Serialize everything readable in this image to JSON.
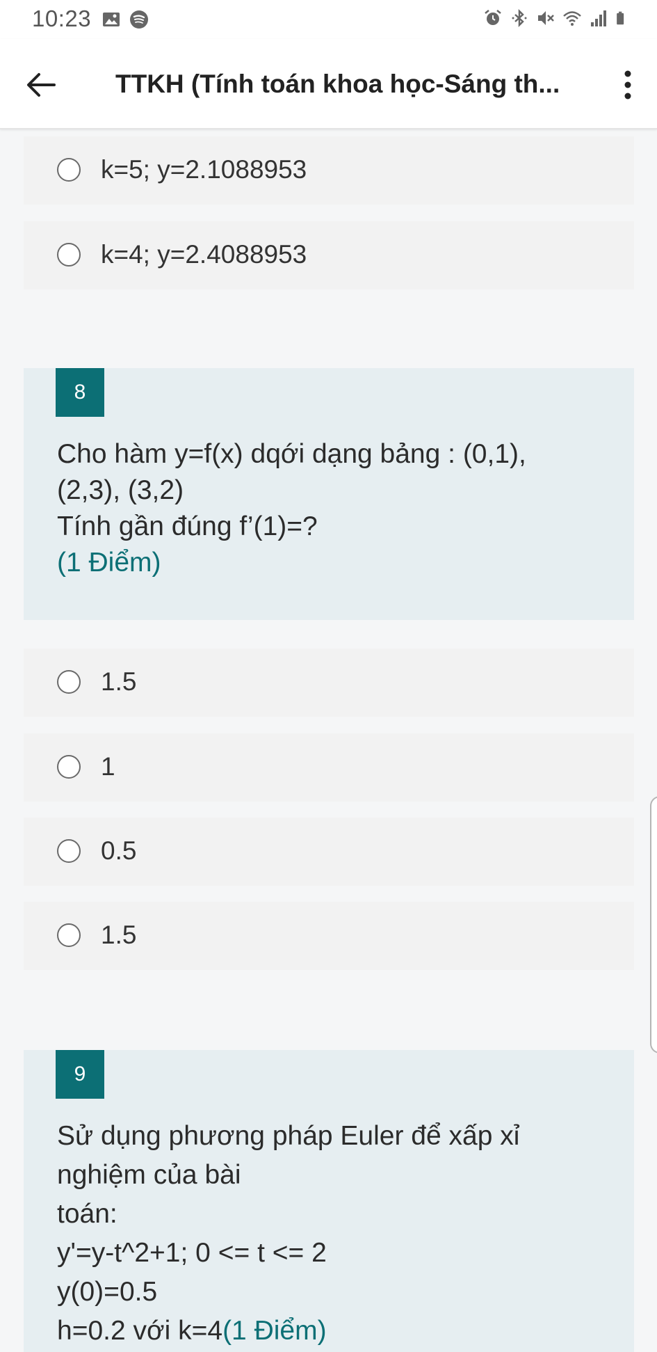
{
  "status_bar": {
    "time": "10:23",
    "left_icons": [
      "gallery-icon",
      "spotify-icon"
    ],
    "right_icons": [
      "alarm-icon",
      "bluetooth-icon",
      "mute-icon",
      "wifi-icon",
      "signal-icon",
      "battery-icon"
    ]
  },
  "app_bar": {
    "title": "TTKH (Tính toán khoa học-Sáng th..."
  },
  "question_7_options": [
    {
      "label": "k=5; y=2.1088953"
    },
    {
      "label": "k=4; y=2.4088953"
    }
  ],
  "question_8": {
    "number": "8",
    "lines": [
      "Cho hàm y=f(x) dqới dạng bảng : (0,1),",
      "(2,3), (3,2)",
      "Tính gần đúng f’(1)=?"
    ],
    "points": "(1 Điểm)",
    "options": [
      {
        "label": "1.5"
      },
      {
        "label": "1"
      },
      {
        "label": "0.5"
      },
      {
        "label": "1.5"
      }
    ]
  },
  "question_9": {
    "number": "9",
    "lines": [
      "Sử dụng phương pháp Euler để xấp xỉ",
      "nghiệm của bài",
      "toán:",
      "y'=y-t^2+1; 0 <= t <= 2",
      "y(0)=0.5"
    ],
    "last_line_prefix": "h=0.2 với k=4",
    "points": "(1 Điểm)"
  },
  "colors": {
    "accent": "#0c6f75",
    "question_bg": "#e6eef1",
    "option_bg": "#f2f2f2"
  }
}
